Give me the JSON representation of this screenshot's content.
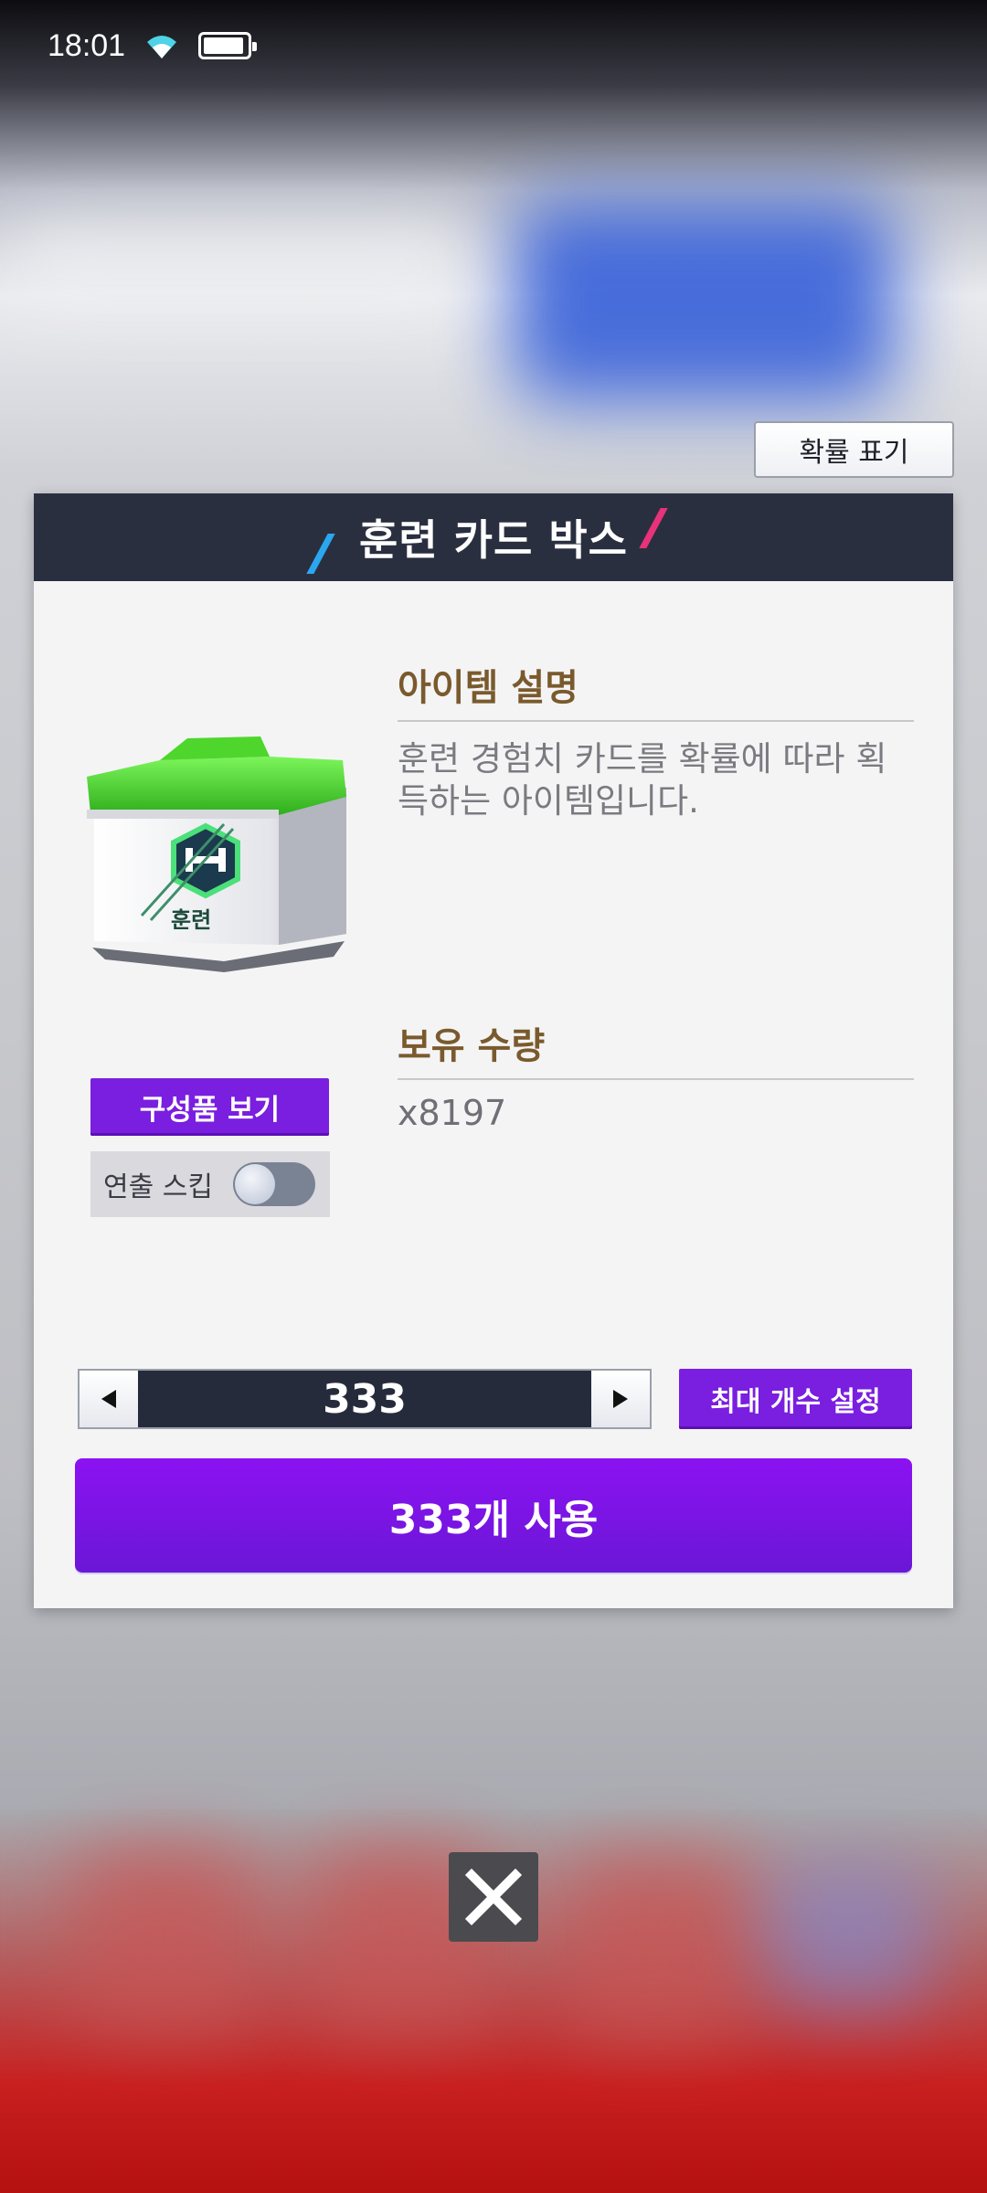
{
  "status_bar": {
    "time": "18:01",
    "wifi_icon": "wifi-icon",
    "battery_icon": "battery-icon"
  },
  "probability_button": {
    "label": "확률 표기"
  },
  "modal": {
    "title": "훈련 카드 박스",
    "item_image_label": "훈련",
    "description_label": "아이템 설명",
    "description_text": "훈련 경험치 카드를 확률에 따라 획득하는 아이템입니다.",
    "owned_label": "보유 수량",
    "owned_count": "x8197",
    "components_button": "구성품 보기",
    "skip_label": "연출 스킵",
    "skip_toggle_on": false,
    "quantity": "333",
    "max_button": "최대 개수 설정",
    "use_button": "333개 사용"
  },
  "close_icon": "close-icon",
  "colors": {
    "accent_purple": "#7a1ee0",
    "header_dark": "#2a2f40",
    "label_brown": "#7a5a2d"
  }
}
